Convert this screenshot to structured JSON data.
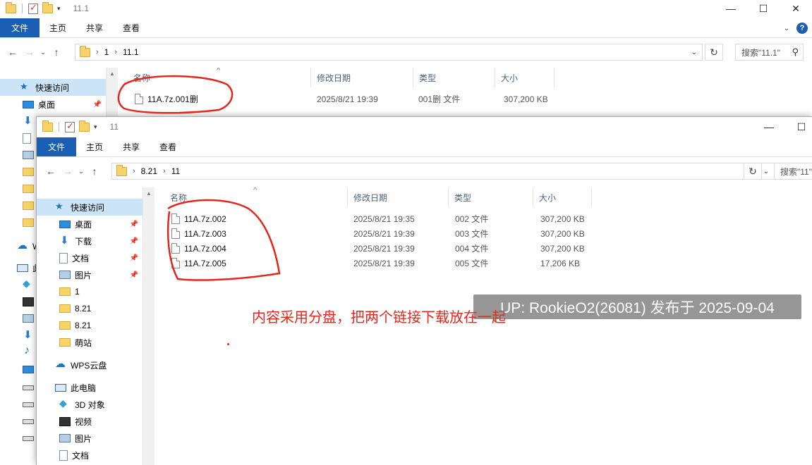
{
  "colors": {
    "accent": "#1a5fb4",
    "selected": "#cce4f7",
    "annotation": "#e8251c"
  },
  "ribbon": {
    "file": "文件",
    "home": "主页",
    "share": "共享",
    "view": "查看"
  },
  "window_controls": {
    "minimize": "—",
    "maximize": "☐",
    "close": "✕"
  },
  "back_window": {
    "title": "11.1",
    "path": [
      "1",
      "11.1"
    ],
    "search_placeholder": "搜索\"11.1\"",
    "columns": {
      "name": "名称",
      "date": "修改日期",
      "type": "类型",
      "size": "大小"
    },
    "files": [
      {
        "name": "11A.7z.001删",
        "date": "2025/8/21 19:39",
        "type": "001删 文件",
        "size": "307,200 KB"
      }
    ],
    "nav": {
      "quick_access": "快速访问",
      "desktop": "桌面"
    }
  },
  "front_window": {
    "title": "11",
    "path": [
      "8.21",
      "11"
    ],
    "search_placeholder": "搜索\"11\"",
    "columns": {
      "name": "名称",
      "date": "修改日期",
      "type": "类型",
      "size": "大小"
    },
    "files": [
      {
        "name": "11A.7z.002",
        "date": "2025/8/21 19:35",
        "type": "002 文件",
        "size": "307,200 KB"
      },
      {
        "name": "11A.7z.003",
        "date": "2025/8/21 19:39",
        "type": "003 文件",
        "size": "307,200 KB"
      },
      {
        "name": "11A.7z.004",
        "date": "2025/8/21 19:39",
        "type": "004 文件",
        "size": "307,200 KB"
      },
      {
        "name": "11A.7z.005",
        "date": "2025/8/21 19:39",
        "type": "005 文件",
        "size": "17,206 KB"
      }
    ],
    "nav": [
      {
        "label": "快速访问",
        "icon": "star",
        "selected": true,
        "pinned": false,
        "indent": 1
      },
      {
        "label": "桌面",
        "icon": "desk",
        "selected": false,
        "pinned": true,
        "indent": 2
      },
      {
        "label": "下载",
        "icon": "down",
        "selected": false,
        "pinned": true,
        "indent": 2
      },
      {
        "label": "文档",
        "icon": "doc",
        "selected": false,
        "pinned": true,
        "indent": 2
      },
      {
        "label": "图片",
        "icon": "pic",
        "selected": false,
        "pinned": true,
        "indent": 2
      },
      {
        "label": "1",
        "icon": "fold",
        "selected": false,
        "pinned": false,
        "indent": 2
      },
      {
        "label": "8.21",
        "icon": "fold",
        "selected": false,
        "pinned": false,
        "indent": 2
      },
      {
        "label": "8.21",
        "icon": "fold",
        "selected": false,
        "pinned": false,
        "indent": 2
      },
      {
        "label": "萌站",
        "icon": "fold",
        "selected": false,
        "pinned": false,
        "indent": 2
      },
      {
        "label": "",
        "icon": "",
        "selected": false,
        "pinned": false,
        "indent": 0
      },
      {
        "label": "WPS云盘",
        "icon": "cloud",
        "selected": false,
        "pinned": false,
        "indent": 1
      },
      {
        "label": "",
        "icon": "",
        "selected": false,
        "pinned": false,
        "indent": 0
      },
      {
        "label": "此电脑",
        "icon": "pc",
        "selected": false,
        "pinned": false,
        "indent": 1
      },
      {
        "label": "3D 对象",
        "icon": "cube",
        "selected": false,
        "pinned": false,
        "indent": 2
      },
      {
        "label": "视频",
        "icon": "film",
        "selected": false,
        "pinned": false,
        "indent": 2
      },
      {
        "label": "图片",
        "icon": "pic",
        "selected": false,
        "pinned": false,
        "indent": 2
      },
      {
        "label": "文档",
        "icon": "doc",
        "selected": false,
        "pinned": false,
        "indent": 2
      }
    ]
  },
  "back_nav_partial": [
    {
      "label": "W",
      "icon": "cloud"
    },
    {
      "label": "此",
      "icon": "pc"
    }
  ],
  "annotation_text": "内容采用分盘，把两个链接下载放在一起",
  "watermark": "UP: RookieO2(26081) 发布于 2025-09-04"
}
